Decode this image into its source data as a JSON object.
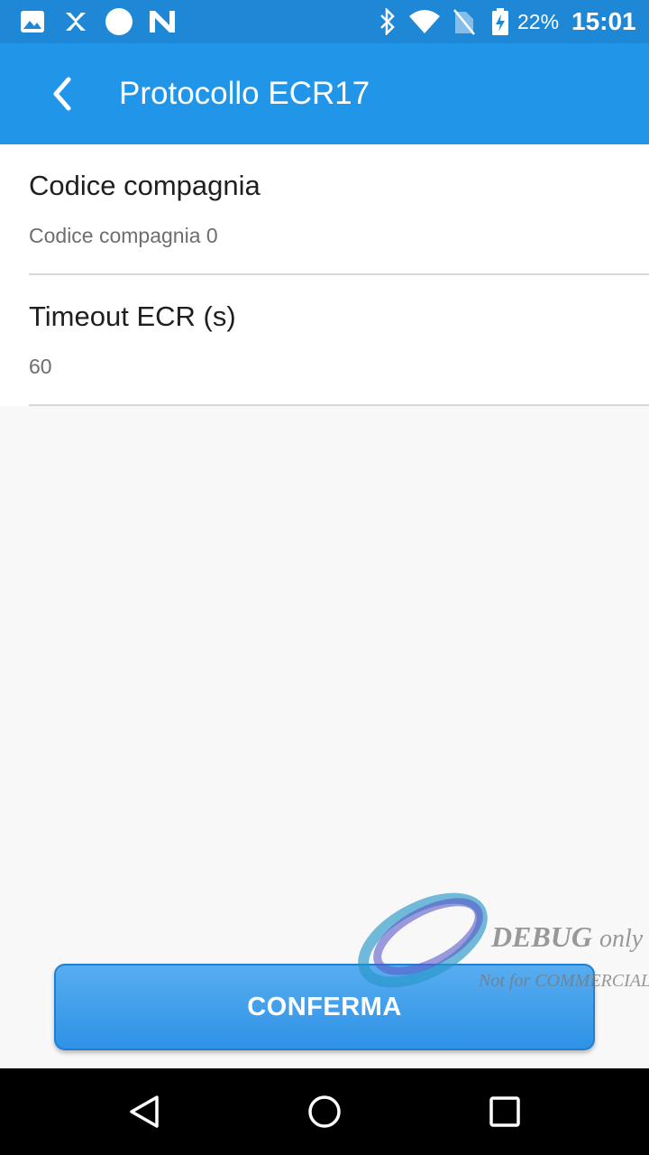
{
  "status_bar": {
    "battery_percent": "22%",
    "time": "15:01",
    "icons_left": [
      "image-icon",
      "x-app-icon",
      "circle-icon",
      "n-app-icon"
    ],
    "icons_right": [
      "bluetooth-icon",
      "wifi-icon",
      "no-sim-icon",
      "battery-charging-icon"
    ]
  },
  "app_bar": {
    "title": "Protocollo ECR17",
    "back_icon": "chevron-left-icon"
  },
  "preferences": [
    {
      "title": "Codice compagnia",
      "summary": "Codice compagnia 0"
    },
    {
      "title": "Timeout ECR (s)",
      "summary": "60"
    }
  ],
  "confirm_button": {
    "label": "CONFERMA"
  },
  "watermark": {
    "line1_bold": "DEBUG",
    "line1_rest": "only",
    "line2": "Not for COMMERCIAL"
  },
  "nav_bar": {
    "back": "back-triangle-icon",
    "home": "home-circle-icon",
    "recents": "recents-square-icon"
  },
  "colors": {
    "status_bar": "#1e88d6",
    "app_bar": "#2196e9",
    "button": "#2e92e6",
    "background": "#f8f8f8"
  }
}
